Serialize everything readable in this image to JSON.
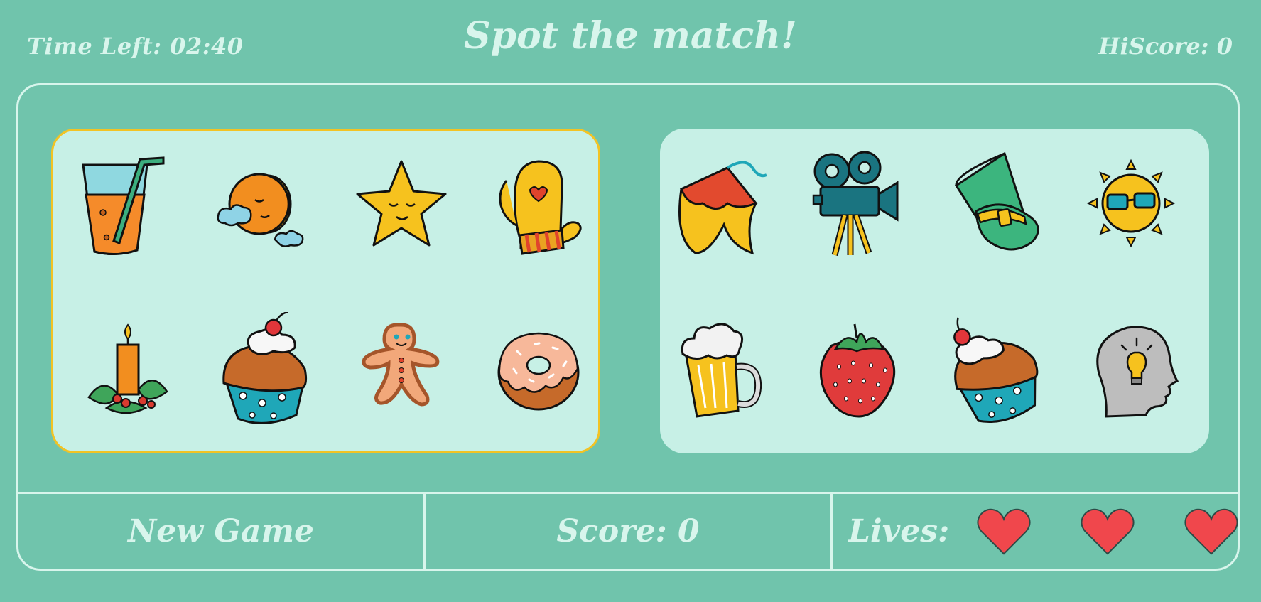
{
  "hud": {
    "timer_label": "Time Left: 02:40",
    "title": "Spot the match!",
    "hiscore_label": "HiScore: 0"
  },
  "left_card": {
    "selected": true,
    "items": [
      "juice-glass",
      "moon",
      "star",
      "oven-mitt",
      "christmas-candle",
      "cupcake",
      "gingerbread-man",
      "donut"
    ]
  },
  "right_card": {
    "selected": false,
    "items": [
      "circus-tent",
      "film-camera",
      "top-hat",
      "sun-with-sunglasses",
      "beer-mug",
      "strawberry",
      "cupcake",
      "head-with-lightbulb"
    ]
  },
  "footer": {
    "new_game_label": "New Game",
    "score_label": "Score: 0",
    "lives_label": "Lives:",
    "lives": 3
  },
  "colors": {
    "background": "#70c4ac",
    "card": "#c7f0e6",
    "selected_border": "#f2c324",
    "text": "#d8f5ec",
    "heart": "#f0474c"
  }
}
